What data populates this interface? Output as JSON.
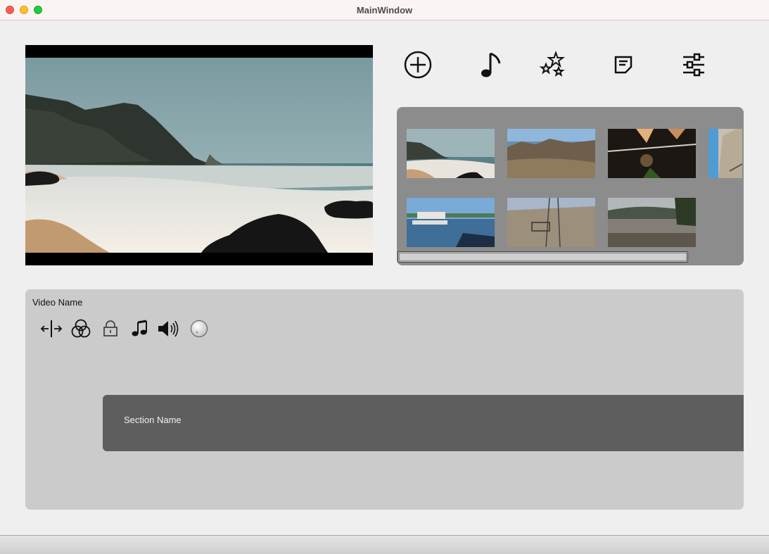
{
  "window": {
    "title": "MainWindow"
  },
  "toolbar": {
    "buttons": [
      {
        "icon": "add-icon",
        "label": "Add"
      },
      {
        "icon": "music-note-icon",
        "label": "Music"
      },
      {
        "icon": "stars-effects-icon",
        "label": "Effects"
      },
      {
        "icon": "text-note-icon",
        "label": "Text"
      },
      {
        "icon": "sliders-icon",
        "label": "Adjust"
      }
    ]
  },
  "library": {
    "clips": [
      {
        "scene": "beach-cliffs"
      },
      {
        "scene": "rocky-coast"
      },
      {
        "scene": "dark-closeup"
      },
      {
        "scene": "rock-wall"
      },
      {
        "scene": "harbor"
      },
      {
        "scene": "ski-lift"
      },
      {
        "scene": "lake"
      }
    ]
  },
  "timeline": {
    "video_name": "Video Name",
    "tools": [
      "split-icon",
      "color-circles-icon",
      "lock-icon",
      "music-note-icon",
      "volume-icon",
      "dial-icon"
    ],
    "section_name": "Section Name"
  },
  "colors": {
    "library_bg": "#8c8c8c",
    "timeline_bg": "#cbcbcb",
    "section_bg": "#5e5e5e"
  }
}
